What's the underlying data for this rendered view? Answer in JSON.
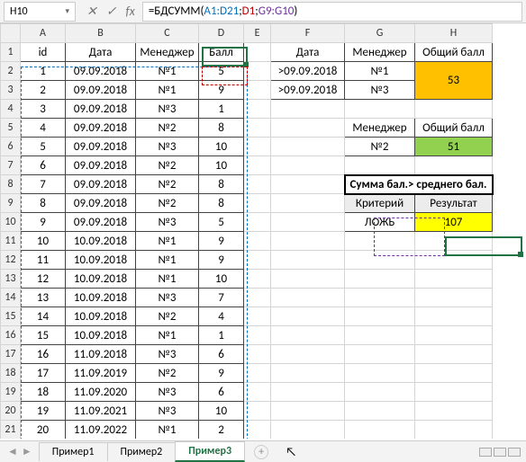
{
  "formula_bar": {
    "name_box": "H10",
    "fx_label": "fx",
    "formula_prefix": "=БДСУММ(",
    "arg1": "A1:D21",
    "sep1": ";",
    "arg2": "D1",
    "sep2": ";",
    "arg3": "G9:G10",
    "suffix": ")"
  },
  "columns": [
    "A",
    "B",
    "C",
    "D",
    "E",
    "F",
    "G",
    "H"
  ],
  "main_table": {
    "headers": [
      "id",
      "Дата",
      "Менеджер",
      "Балл"
    ],
    "rows": [
      [
        "1",
        "09.09.2018",
        "№1",
        "5"
      ],
      [
        "2",
        "09.09.2018",
        "№1",
        "9"
      ],
      [
        "3",
        "09.09.2018",
        "№3",
        "1"
      ],
      [
        "4",
        "09.09.2018",
        "№2",
        "8"
      ],
      [
        "5",
        "09.09.2018",
        "№3",
        "10"
      ],
      [
        "6",
        "09.09.2018",
        "№2",
        "10"
      ],
      [
        "7",
        "09.09.2018",
        "№2",
        "8"
      ],
      [
        "8",
        "09.09.2018",
        "№2",
        "8"
      ],
      [
        "9",
        "09.09.2018",
        "№3",
        "5"
      ],
      [
        "10",
        "10.09.2018",
        "№1",
        "9"
      ],
      [
        "11",
        "10.09.2018",
        "№1",
        "9"
      ],
      [
        "12",
        "10.09.2018",
        "№1",
        "10"
      ],
      [
        "13",
        "10.09.2018",
        "№3",
        "7"
      ],
      [
        "14",
        "10.09.2018",
        "№2",
        "4"
      ],
      [
        "15",
        "10.09.2018",
        "№1",
        "1"
      ],
      [
        "16",
        "11.09.2018",
        "№3",
        "6"
      ],
      [
        "17",
        "11.09.2019",
        "№2",
        "9"
      ],
      [
        "18",
        "11.09.2020",
        "№3",
        "6"
      ],
      [
        "19",
        "11.09.2021",
        "№3",
        "10"
      ],
      [
        "20",
        "11.09.2022",
        "№1",
        "2"
      ]
    ]
  },
  "side1": {
    "headers": [
      "Дата",
      "Менеджер",
      "Общий балл"
    ],
    "rows": [
      [
        ">09.09.2018",
        "№1"
      ],
      [
        ">09.09.2018",
        "№3"
      ]
    ],
    "result": "53"
  },
  "side2": {
    "headers": [
      "Менеджер",
      "Общий балл"
    ],
    "row": [
      "№2",
      "51"
    ]
  },
  "side3": {
    "title": "Сумма бал.> среднего бал.",
    "crit_label": "Критерий",
    "result_label": "Результат",
    "crit_value": "ЛОЖЬ",
    "result_value": "107"
  },
  "tabs": [
    "Пример1",
    "Пример2",
    "Пример3"
  ],
  "active_tab": 2
}
